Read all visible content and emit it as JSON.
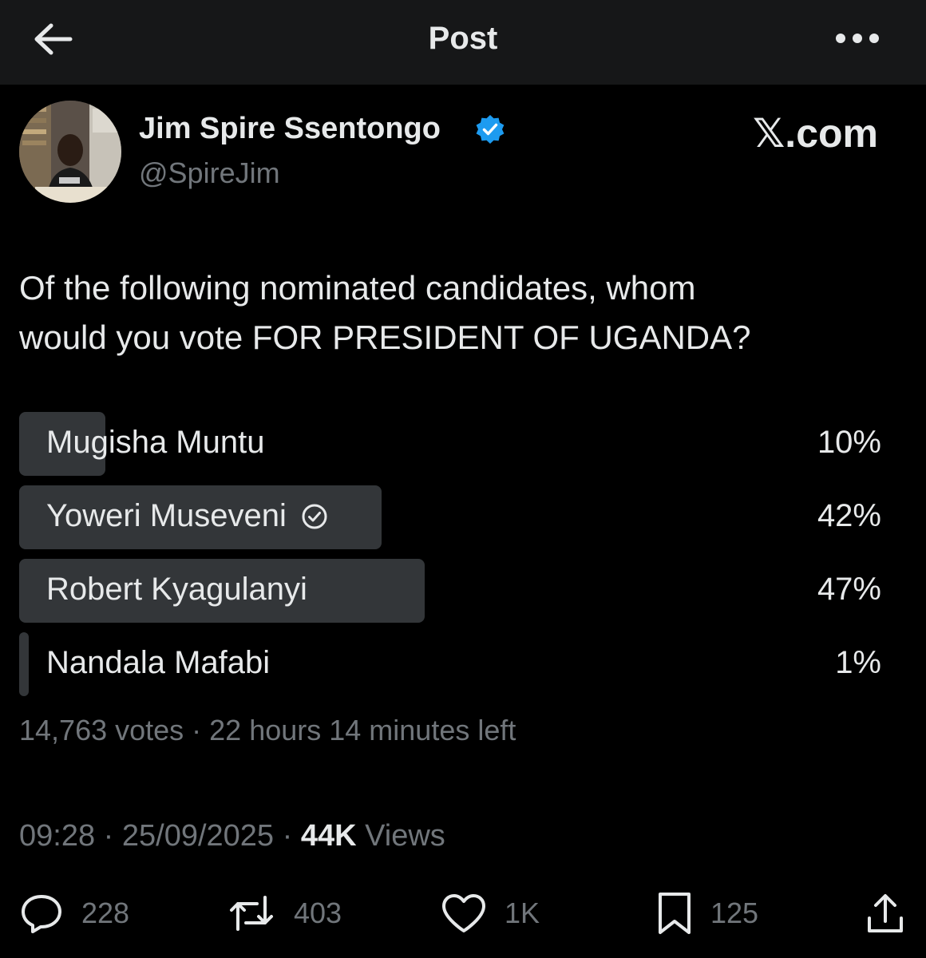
{
  "header": {
    "title": "Post",
    "back_icon": "arrow-left-icon",
    "more_icon": "more-horizontal-icon"
  },
  "author": {
    "display_name": "Jim Spire Ssentongo",
    "handle": "@SpireJim",
    "verified": true,
    "verified_color": "#1d9bf0"
  },
  "watermark": "𝕏.com",
  "tweet": {
    "text_line1": "Of the following nominated candidates, whom",
    "text_line2": "would you vote FOR PRESIDENT OF UGANDA?"
  },
  "poll": {
    "options": [
      {
        "label": "Mugisha Muntu",
        "percent_label": "10%",
        "fraction": 0.1,
        "voted": false
      },
      {
        "label": "Yoweri Museveni",
        "percent_label": "42%",
        "fraction": 0.42,
        "voted": true
      },
      {
        "label": "Robert Kyagulanyi",
        "percent_label": "47%",
        "fraction": 0.47,
        "voted": false
      },
      {
        "label": "Nandala Mafabi",
        "percent_label": "1%",
        "fraction": 0.01,
        "voted": false
      }
    ],
    "votes": "14,763 votes",
    "separator": " · ",
    "time_left": "22 hours 14 minutes left"
  },
  "meta": {
    "time": "09:28",
    "date": "25/09/2025",
    "separator": " · ",
    "views_count": "44K",
    "views_label": "Views"
  },
  "actions": {
    "replies": "228",
    "reposts": "403",
    "likes": "1K",
    "bookmarks": "125"
  },
  "colors": {
    "background": "#000000",
    "text": "#e7e9ea",
    "muted": "#71767b",
    "poll_fill": "#333639",
    "header_bg": "#161718"
  }
}
